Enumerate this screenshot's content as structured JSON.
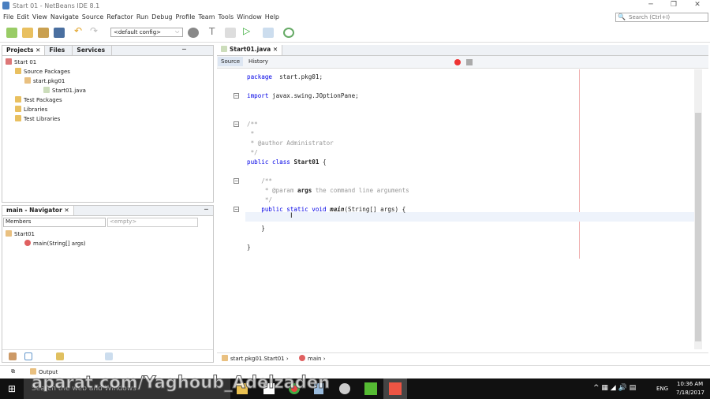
{
  "window": {
    "title": "Start 01 - NetBeans IDE 8.1",
    "search_placeholder": "Search (Ctrl+I)"
  },
  "menu": [
    "File",
    "Edit",
    "View",
    "Navigate",
    "Source",
    "Refactor",
    "Run",
    "Debug",
    "Profile",
    "Team",
    "Tools",
    "Window",
    "Help"
  ],
  "toolbar": {
    "config": "<default config>"
  },
  "projects": {
    "tabs": [
      "Projects",
      "Files",
      "Services"
    ],
    "tree": [
      "Start 01",
      "Source Packages",
      "start.pkg01",
      "Start01.java",
      "Test Packages",
      "Libraries",
      "Test Libraries"
    ]
  },
  "navigator": {
    "title": "main - Navigator",
    "filter": "Members",
    "search_placeholder": "<empty>",
    "tree": [
      "Start01",
      "main(String[] args)"
    ]
  },
  "editor": {
    "tab": "Start01.java",
    "source_tab": "Source",
    "history_tab": "History",
    "lines": [
      [
        [
          "kw",
          "package"
        ],
        [
          "",
          "  start.pkg01;"
        ]
      ],
      [],
      [
        [
          "kw",
          "import"
        ],
        [
          "",
          " javax.swing.JOptionPane;"
        ]
      ],
      [],
      [],
      [
        [
          "cm",
          "/**"
        ]
      ],
      [
        [
          "cm",
          " *"
        ]
      ],
      [
        [
          "cm",
          " * @author Administrator"
        ]
      ],
      [
        [
          "cm",
          " */"
        ]
      ],
      [
        [
          "kw",
          "public class "
        ],
        [
          "b",
          "Start01"
        ],
        [
          "",
          " {"
        ]
      ],
      [],
      [
        [
          "cm",
          "    /**"
        ]
      ],
      [
        [
          "cm",
          "     * @param "
        ],
        [
          "b",
          "args"
        ],
        [
          "cm",
          " the command line arguments"
        ]
      ],
      [
        [
          "cm",
          "     */"
        ]
      ],
      [
        [
          "kw",
          "    public static void "
        ],
        [
          "it",
          "main"
        ],
        [
          "",
          "(String[] args) {"
        ]
      ],
      [],
      [
        [
          "",
          "    }"
        ]
      ],
      [],
      [
        [
          "",
          "}"
        ]
      ]
    ]
  },
  "breadcrumb": [
    "start.pkg01.Start01",
    "main"
  ],
  "output": {
    "label": "Output"
  },
  "taskbar": {
    "search": "Search the web and Windows",
    "lang": "ENG",
    "time": "10:36 AM",
    "date": "7/18/2017"
  },
  "watermark": "aparat.com/Yaghoub_Adelzaden",
  "colors": {
    "keyword": "#0000e6",
    "comment": "#999999",
    "margin_line": "#f0b0b0"
  }
}
